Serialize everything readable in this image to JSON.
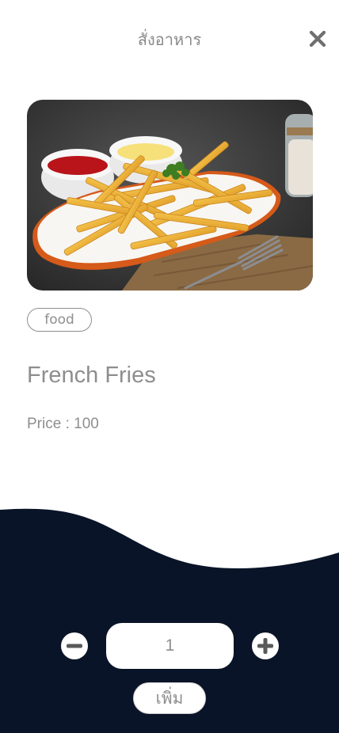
{
  "header": {
    "title": "สั่งอาหาร",
    "close_icon": "close-icon"
  },
  "item": {
    "image_alt": "french-fries-photo",
    "tag": "food",
    "name": "French Fries",
    "price_label": "Price",
    "price_separator": " : ",
    "price_value": "100"
  },
  "order": {
    "quantity": "1",
    "minus_icon": "minus-circle-icon",
    "plus_icon": "plus-circle-icon",
    "add_label": "เพิ่ม"
  },
  "colors": {
    "text_gray": "#8e8e8e",
    "panel_navy": "#0a1428",
    "background": "#ffffff"
  }
}
